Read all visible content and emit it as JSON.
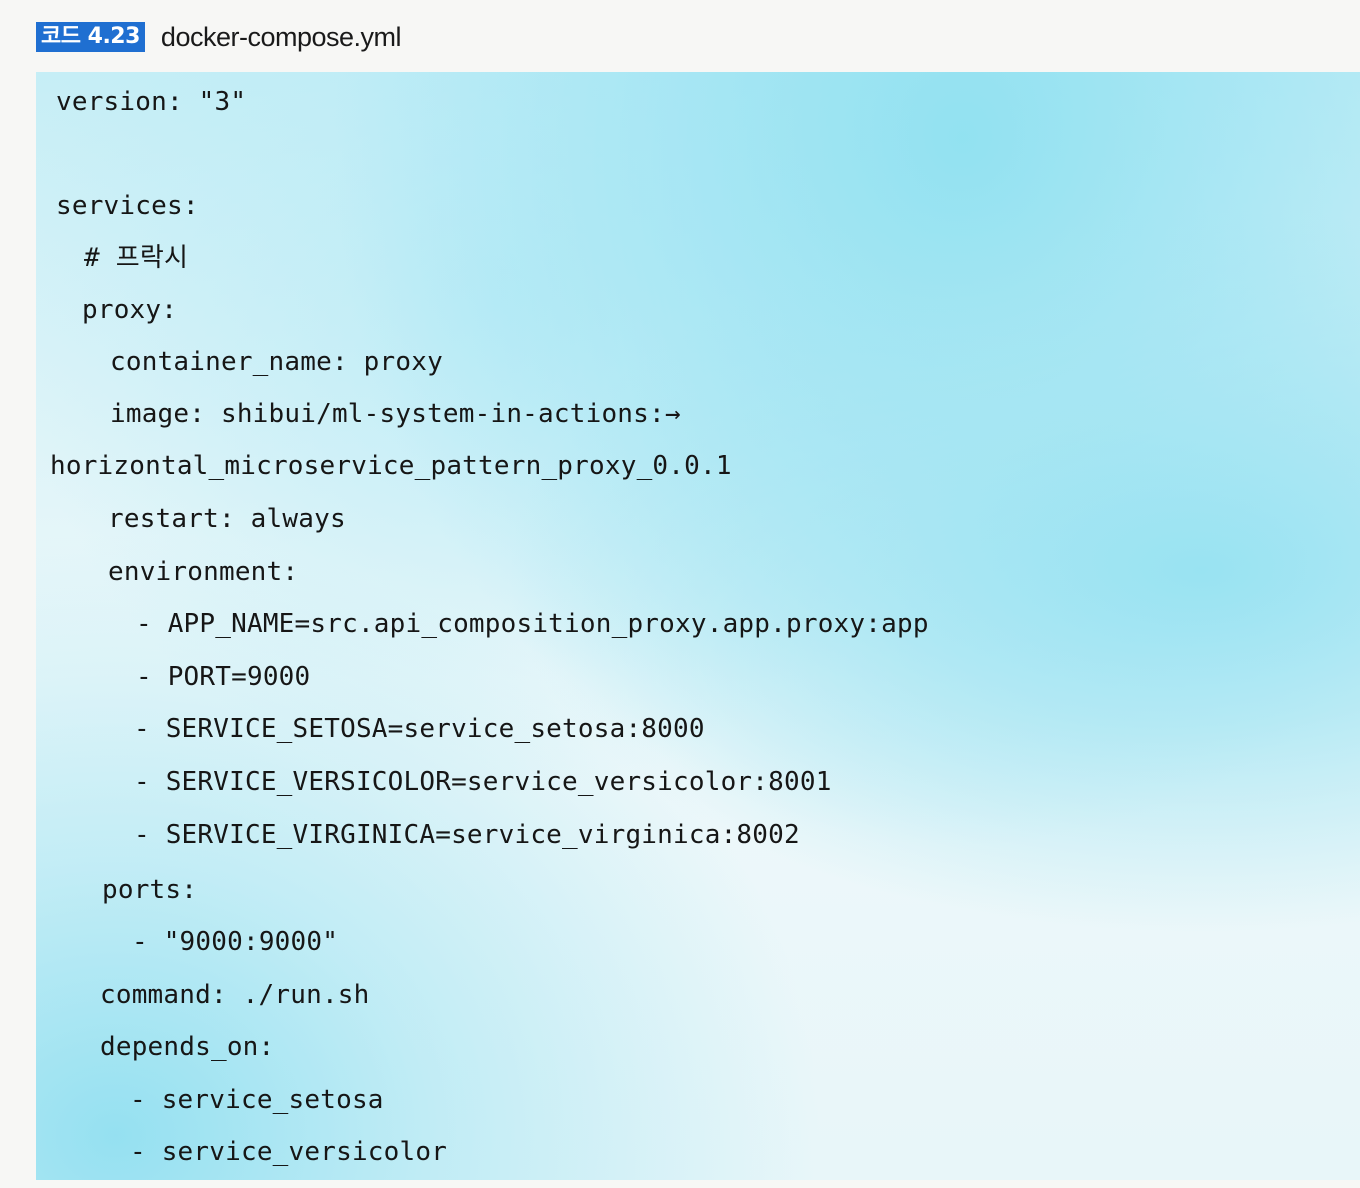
{
  "caption": {
    "badge": "코드 4.23",
    "title": "docker-compose.yml"
  },
  "code_lines": [
    "version: \"3\"",
    "services:",
    "# 프락시",
    "proxy:",
    "container_name: proxy",
    "image: shibui/ml-system-in-actions:→",
    "horizontal_microservice_pattern_proxy_0.0.1",
    "restart: always",
    "environment:",
    "- APP_NAME=src.api_composition_proxy.app.proxy:app",
    "- PORT=9000",
    "- SERVICE_SETOSA=service_setosa:8000",
    "- SERVICE_VERSICOLOR=service_versicolor:8001",
    "- SERVICE_VIRGINICA=service_virginica:8002",
    "ports:",
    "- \"9000:9000\"",
    "command: ./run.sh",
    "depends_on:",
    "- service_setosa",
    "- service_versicolor"
  ]
}
